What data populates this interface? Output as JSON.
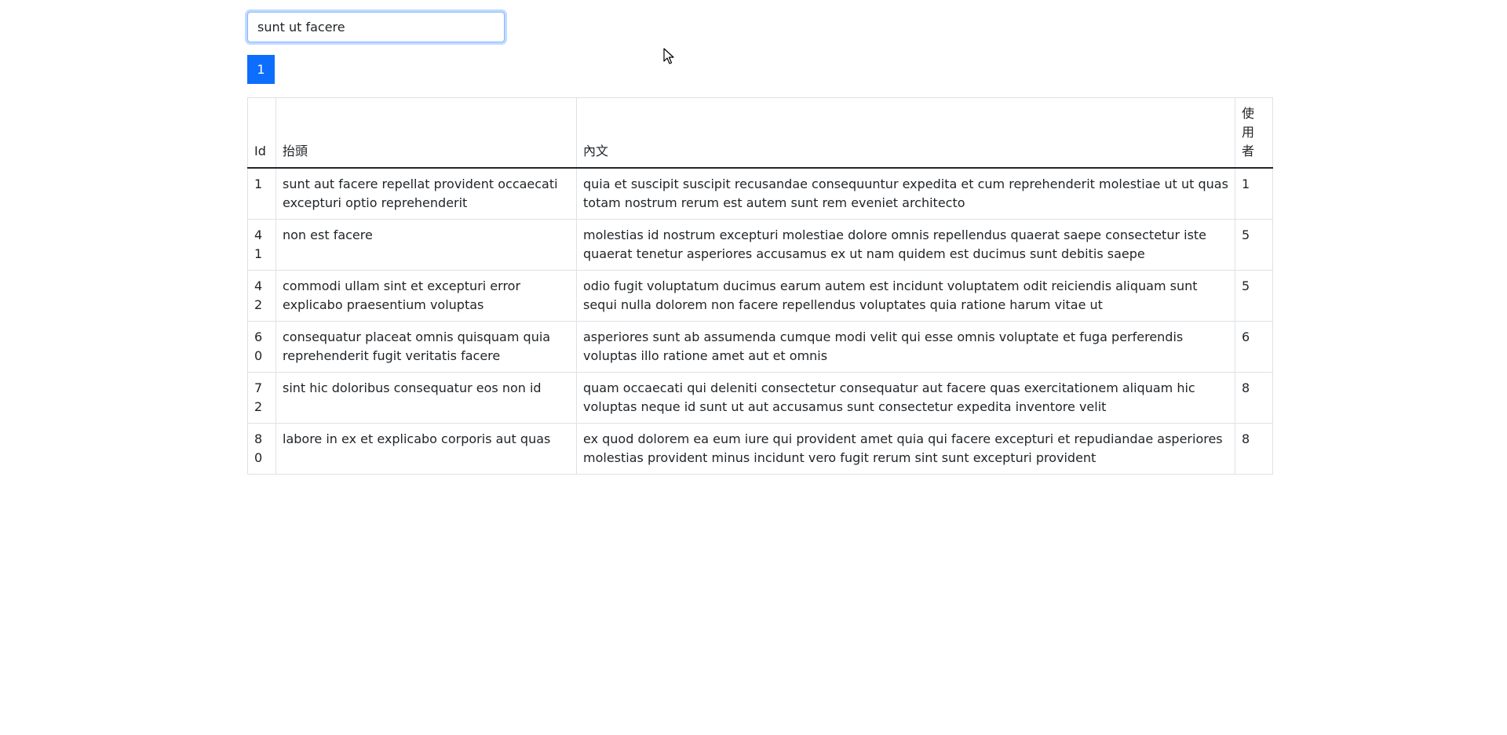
{
  "search": {
    "value": "sunt ut facere"
  },
  "pagination": {
    "pages": [
      "1"
    ],
    "active_color": "#0d6efd"
  },
  "table": {
    "headers": {
      "id": "Id",
      "title": "抬頭",
      "body": "內文",
      "user": "使用者"
    },
    "rows": [
      {
        "id": "1",
        "title": "sunt aut facere repellat provident occaecati excepturi optio reprehenderit",
        "body": "quia et suscipit suscipit recusandae consequuntur expedita et cum reprehenderit molestiae ut ut quas totam nostrum rerum est autem sunt rem eveniet architecto",
        "user": "1"
      },
      {
        "id": "41",
        "title": "non est facere",
        "body": "molestias id nostrum excepturi molestiae dolore omnis repellendus quaerat saepe consectetur iste quaerat tenetur asperiores accusamus ex ut nam quidem est ducimus sunt debitis saepe",
        "user": "5"
      },
      {
        "id": "42",
        "title": "commodi ullam sint et excepturi error explicabo praesentium voluptas",
        "body": "odio fugit voluptatum ducimus earum autem est incidunt voluptatem odit reiciendis aliquam sunt sequi nulla dolorem non facere repellendus voluptates quia ratione harum vitae ut",
        "user": "5"
      },
      {
        "id": "60",
        "title": "consequatur placeat omnis quisquam quia reprehenderit fugit veritatis facere",
        "body": "asperiores sunt ab assumenda cumque modi velit qui esse omnis voluptate et fuga perferendis voluptas illo ratione amet aut et omnis",
        "user": "6"
      },
      {
        "id": "72",
        "title": "sint hic doloribus consequatur eos non id",
        "body": "quam occaecati qui deleniti consectetur consequatur aut facere quas exercitationem aliquam hic voluptas neque id sunt ut aut accusamus sunt consectetur expedita inventore velit",
        "user": "8"
      },
      {
        "id": "80",
        "title": "labore in ex et explicabo corporis aut quas",
        "body": "ex quod dolorem ea eum iure qui provident amet quia qui facere excepturi et repudiandae asperiores molestias provident minus incidunt vero fugit rerum sint sunt excepturi provident",
        "user": "8"
      }
    ]
  }
}
